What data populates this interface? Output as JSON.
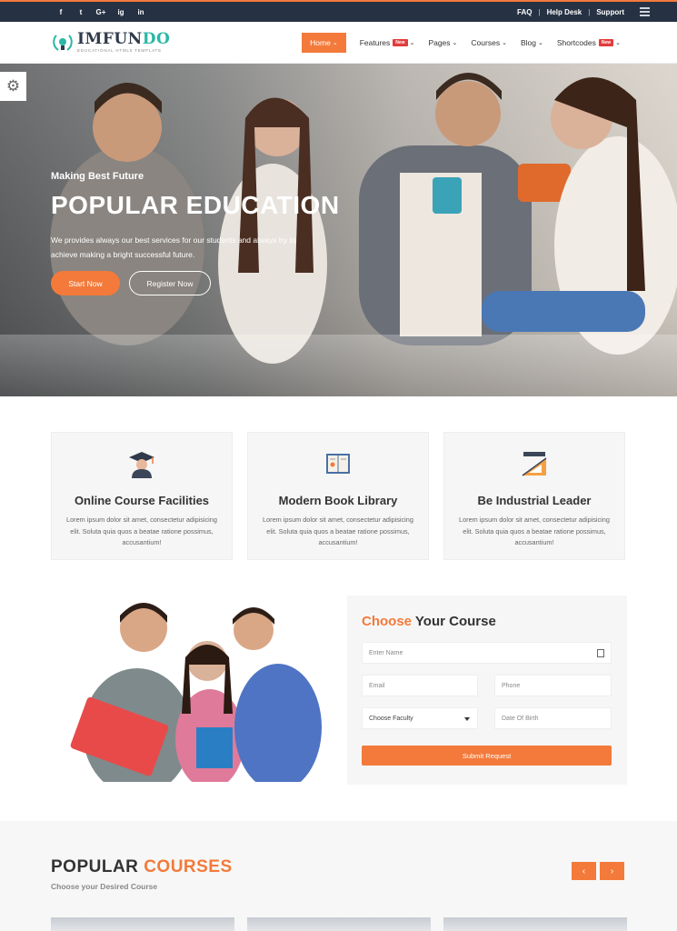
{
  "topbar": {
    "social": [
      "f",
      "t",
      "G+",
      "ig",
      "in"
    ],
    "links": [
      "FAQ",
      "Help Desk",
      "Support"
    ]
  },
  "logo": {
    "name_a": "IMFUN",
    "name_b": "DO",
    "tagline": "EDUCATIONAL HTML5 TEMPLATE"
  },
  "nav": {
    "items": [
      {
        "label": "Home",
        "badge": ""
      },
      {
        "label": "Features",
        "badge": "New"
      },
      {
        "label": "Pages",
        "badge": ""
      },
      {
        "label": "Courses",
        "badge": ""
      },
      {
        "label": "Blog",
        "badge": ""
      },
      {
        "label": "Shortcodes",
        "badge": "New"
      }
    ]
  },
  "hero": {
    "kicker": "Making Best Future",
    "title": "POPULAR EDUCATION",
    "desc": "We provides always our best services for our students and always try to achieve making a bright successful future.",
    "btn_primary": "Start Now",
    "btn_secondary": "Register Now"
  },
  "features": [
    {
      "icon": "graduate-icon",
      "title": "Online Course Facilities",
      "text": "Lorem ipsum dolor sit amet, consectetur adipisicing elit. Soluta quia quos a beatae ratione possimus, accusantium!"
    },
    {
      "icon": "book-icon",
      "title": "Modern Book Library",
      "text": "Lorem ipsum dolor sit amet, consectetur adipisicing elit. Soluta quia quos a beatae ratione possimus, accusantium!"
    },
    {
      "icon": "ruler-triangle-icon",
      "title": "Be Industrial Leader",
      "text": "Lorem ipsum dolor sit amet, consectetur adipisicing elit. Soluta quia quos a beatae ratione possimus, accusantium!"
    }
  ],
  "form": {
    "title_hl": "Choose",
    "title_rest": " Your Course",
    "name_placeholder": "Enter Name",
    "email_placeholder": "Email",
    "phone_placeholder": "Phone",
    "faculty_selected": "Choose Faculty",
    "dob_placeholder": "Date Of Birth",
    "submit": "Submit Request"
  },
  "courses": {
    "title_a": "POPULAR ",
    "title_b": "COURSES",
    "subtitle": "Choose your Desired Course",
    "prev": "‹",
    "next": "›"
  },
  "colors": {
    "accent": "#f37a3a",
    "dark": "#263244",
    "badge": "#e23c3c"
  }
}
